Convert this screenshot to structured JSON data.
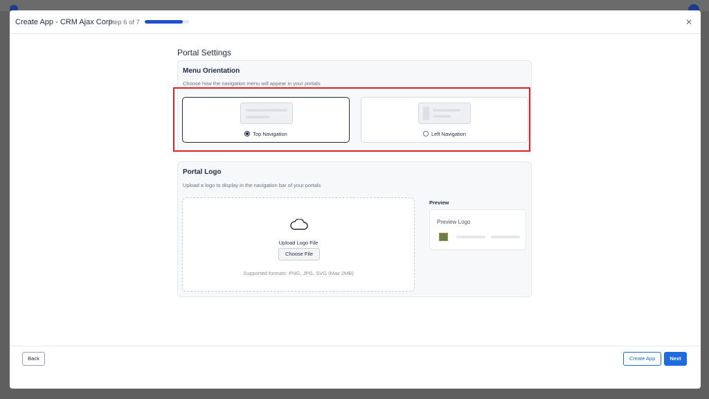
{
  "header": {
    "title": "Create App  - CRM Ajax Corp",
    "step": "Step 6 of 7",
    "progress": 0.857
  },
  "section_title": "Portal Settings",
  "menu_orientation": {
    "title": "Menu Orientation",
    "description": "Choose how the navigation menu will appear in your portals",
    "options": [
      {
        "label": "Top Navigation",
        "selected": true
      },
      {
        "label": "Left Navigation",
        "selected": false
      }
    ]
  },
  "portal_logo": {
    "title": "Portal Logo",
    "description": "Upload a logo to display in the navigation bar of your portals",
    "upload_label": "Upload Logo File",
    "choose_button": "Choose File",
    "formats": "Supported formats: PNG, JPG, SVG (Max 2MB)",
    "preview_label": "Preview",
    "preview_title": "Preview Logo"
  },
  "footer": {
    "back": "Back",
    "create_app": "Create App",
    "next": "Next"
  },
  "colors": {
    "accent": "#1e6ae0",
    "progress": "#1e4fcf",
    "highlight": "#e01f1f"
  }
}
